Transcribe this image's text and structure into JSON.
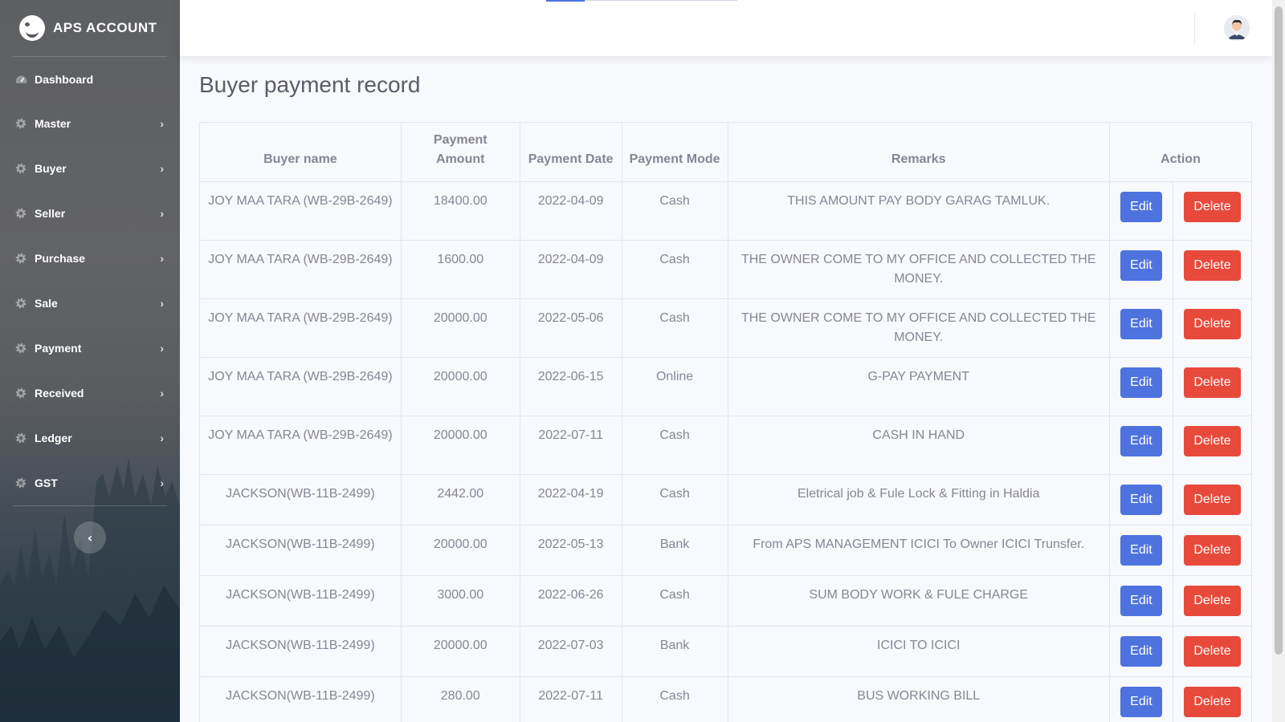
{
  "brand": {
    "name": "APS ACCOUNT",
    "icon": "smiley-logo-icon"
  },
  "sidebar": {
    "items": [
      {
        "label": "Dashboard",
        "icon": "dashboard-gauge-icon",
        "has_submenu": false
      },
      {
        "label": "Master",
        "icon": "gear-icon",
        "has_submenu": true
      },
      {
        "label": "Buyer",
        "icon": "gear-icon",
        "has_submenu": true
      },
      {
        "label": "Seller",
        "icon": "gear-icon",
        "has_submenu": true
      },
      {
        "label": "Purchase",
        "icon": "gear-icon",
        "has_submenu": true
      },
      {
        "label": "Sale",
        "icon": "gear-icon",
        "has_submenu": true
      },
      {
        "label": "Payment",
        "icon": "gear-icon",
        "has_submenu": true
      },
      {
        "label": "Received",
        "icon": "gear-icon",
        "has_submenu": true
      },
      {
        "label": "Ledger",
        "icon": "gear-icon",
        "has_submenu": true
      },
      {
        "label": "GST",
        "icon": "gear-icon",
        "has_submenu": true
      }
    ],
    "toggle_icon": "chevron-left-icon"
  },
  "topbar": {
    "avatar_icon": "user-avatar-icon"
  },
  "page": {
    "title": "Buyer payment record"
  },
  "table": {
    "headers": {
      "buyer_name": "Buyer name",
      "payment_amount": "Payment Amount",
      "payment_date": "Payment Date",
      "payment_mode": "Payment Mode",
      "remarks": "Remarks",
      "action": "Action"
    },
    "edit_label": "Edit",
    "delete_label": "Delete",
    "rows": [
      {
        "buyer": "JOY MAA TARA (WB-29B-2649)",
        "amount": "18400.00",
        "date": "2022-04-09",
        "mode": "Cash",
        "remarks": "THIS AMOUNT PAY BODY GARAG TAMLUK."
      },
      {
        "buyer": "JOY MAA TARA (WB-29B-2649)",
        "amount": "1600.00",
        "date": "2022-04-09",
        "mode": "Cash",
        "remarks": "THE OWNER COME TO MY OFFICE AND COLLECTED THE MONEY."
      },
      {
        "buyer": "JOY MAA TARA (WB-29B-2649)",
        "amount": "20000.00",
        "date": "2022-05-06",
        "mode": "Cash",
        "remarks": "THE OWNER COME TO MY OFFICE AND COLLECTED THE MONEY."
      },
      {
        "buyer": "JOY MAA TARA (WB-29B-2649)",
        "amount": "20000.00",
        "date": "2022-06-15",
        "mode": "Online",
        "remarks": "G-PAY PAYMENT"
      },
      {
        "buyer": "JOY MAA TARA (WB-29B-2649)",
        "amount": "20000.00",
        "date": "2022-07-11",
        "mode": "Cash",
        "remarks": "CASH IN HAND"
      },
      {
        "buyer": "JACKSON(WB-11B-2499)",
        "amount": "2442.00",
        "date": "2022-04-19",
        "mode": "Cash",
        "remarks": "Eletrical job & Fule Lock & Fitting in Haldia"
      },
      {
        "buyer": "JACKSON(WB-11B-2499)",
        "amount": "20000.00",
        "date": "2022-05-13",
        "mode": "Bank",
        "remarks": "From APS MANAGEMENT ICICI To Owner ICICI Trunsfer."
      },
      {
        "buyer": "JACKSON(WB-11B-2499)",
        "amount": "3000.00",
        "date": "2022-06-26",
        "mode": "Cash",
        "remarks": "SUM BODY WORK & FULE CHARGE"
      },
      {
        "buyer": "JACKSON(WB-11B-2499)",
        "amount": "20000.00",
        "date": "2022-07-03",
        "mode": "Bank",
        "remarks": "ICICI TO ICICI"
      },
      {
        "buyer": "JACKSON(WB-11B-2499)",
        "amount": "280.00",
        "date": "2022-07-11",
        "mode": "Cash",
        "remarks": "BUS WORKING BILL"
      }
    ]
  },
  "colors": {
    "primary": "#4e73df",
    "danger": "#e74a3b",
    "text": "#858796",
    "title": "#5a5c69"
  }
}
